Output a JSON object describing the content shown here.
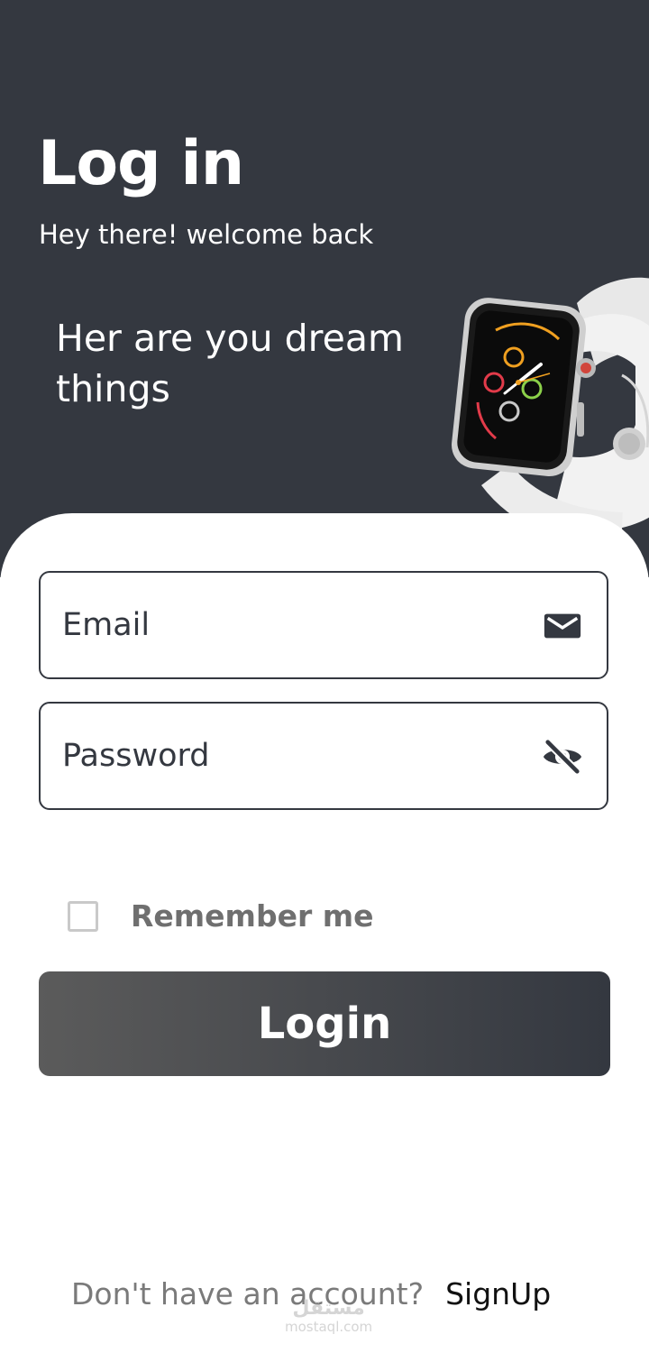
{
  "header": {
    "title": "Log in",
    "subtitle": "Hey there! welcome back",
    "tagline": "Her are you dream things"
  },
  "form": {
    "email_placeholder": "Email",
    "password_placeholder": "Password",
    "remember_label": "Remember me",
    "remember_checked": false,
    "login_label": "Login"
  },
  "footer": {
    "question": "Don't have an account?",
    "signup_label": "SignUp"
  },
  "watermark": {
    "arabic": "مستقل",
    "latin": "mostaql.com"
  },
  "icons": {
    "email": "mail-icon",
    "password": "eye-off-icon",
    "product": "smartwatch-image"
  },
  "colors": {
    "dark": "#343840",
    "button_gradient_start": "#5b5b5b",
    "white": "#ffffff"
  }
}
